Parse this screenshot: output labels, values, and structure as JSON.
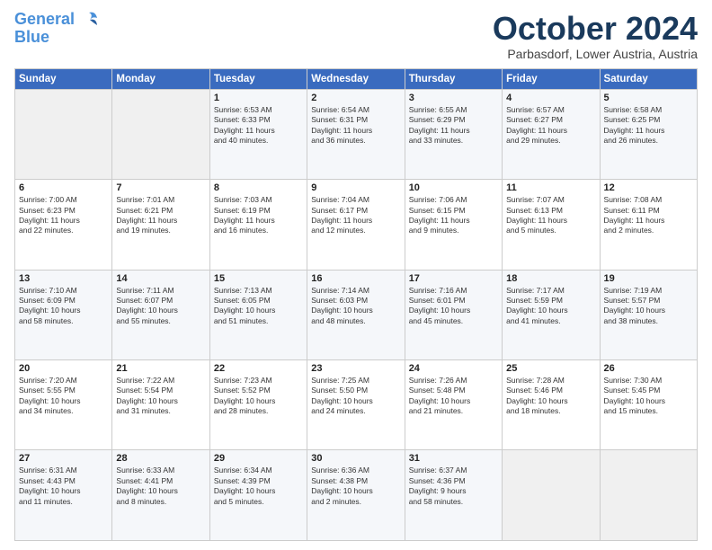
{
  "logo": {
    "line1": "General",
    "line2": "Blue"
  },
  "title": "October 2024",
  "location": "Parbasdorf, Lower Austria, Austria",
  "weekdays": [
    "Sunday",
    "Monday",
    "Tuesday",
    "Wednesday",
    "Thursday",
    "Friday",
    "Saturday"
  ],
  "weeks": [
    [
      {
        "day": "",
        "info": ""
      },
      {
        "day": "",
        "info": ""
      },
      {
        "day": "1",
        "info": "Sunrise: 6:53 AM\nSunset: 6:33 PM\nDaylight: 11 hours\nand 40 minutes."
      },
      {
        "day": "2",
        "info": "Sunrise: 6:54 AM\nSunset: 6:31 PM\nDaylight: 11 hours\nand 36 minutes."
      },
      {
        "day": "3",
        "info": "Sunrise: 6:55 AM\nSunset: 6:29 PM\nDaylight: 11 hours\nand 33 minutes."
      },
      {
        "day": "4",
        "info": "Sunrise: 6:57 AM\nSunset: 6:27 PM\nDaylight: 11 hours\nand 29 minutes."
      },
      {
        "day": "5",
        "info": "Sunrise: 6:58 AM\nSunset: 6:25 PM\nDaylight: 11 hours\nand 26 minutes."
      }
    ],
    [
      {
        "day": "6",
        "info": "Sunrise: 7:00 AM\nSunset: 6:23 PM\nDaylight: 11 hours\nand 22 minutes."
      },
      {
        "day": "7",
        "info": "Sunrise: 7:01 AM\nSunset: 6:21 PM\nDaylight: 11 hours\nand 19 minutes."
      },
      {
        "day": "8",
        "info": "Sunrise: 7:03 AM\nSunset: 6:19 PM\nDaylight: 11 hours\nand 16 minutes."
      },
      {
        "day": "9",
        "info": "Sunrise: 7:04 AM\nSunset: 6:17 PM\nDaylight: 11 hours\nand 12 minutes."
      },
      {
        "day": "10",
        "info": "Sunrise: 7:06 AM\nSunset: 6:15 PM\nDaylight: 11 hours\nand 9 minutes."
      },
      {
        "day": "11",
        "info": "Sunrise: 7:07 AM\nSunset: 6:13 PM\nDaylight: 11 hours\nand 5 minutes."
      },
      {
        "day": "12",
        "info": "Sunrise: 7:08 AM\nSunset: 6:11 PM\nDaylight: 11 hours\nand 2 minutes."
      }
    ],
    [
      {
        "day": "13",
        "info": "Sunrise: 7:10 AM\nSunset: 6:09 PM\nDaylight: 10 hours\nand 58 minutes."
      },
      {
        "day": "14",
        "info": "Sunrise: 7:11 AM\nSunset: 6:07 PM\nDaylight: 10 hours\nand 55 minutes."
      },
      {
        "day": "15",
        "info": "Sunrise: 7:13 AM\nSunset: 6:05 PM\nDaylight: 10 hours\nand 51 minutes."
      },
      {
        "day": "16",
        "info": "Sunrise: 7:14 AM\nSunset: 6:03 PM\nDaylight: 10 hours\nand 48 minutes."
      },
      {
        "day": "17",
        "info": "Sunrise: 7:16 AM\nSunset: 6:01 PM\nDaylight: 10 hours\nand 45 minutes."
      },
      {
        "day": "18",
        "info": "Sunrise: 7:17 AM\nSunset: 5:59 PM\nDaylight: 10 hours\nand 41 minutes."
      },
      {
        "day": "19",
        "info": "Sunrise: 7:19 AM\nSunset: 5:57 PM\nDaylight: 10 hours\nand 38 minutes."
      }
    ],
    [
      {
        "day": "20",
        "info": "Sunrise: 7:20 AM\nSunset: 5:55 PM\nDaylight: 10 hours\nand 34 minutes."
      },
      {
        "day": "21",
        "info": "Sunrise: 7:22 AM\nSunset: 5:54 PM\nDaylight: 10 hours\nand 31 minutes."
      },
      {
        "day": "22",
        "info": "Sunrise: 7:23 AM\nSunset: 5:52 PM\nDaylight: 10 hours\nand 28 minutes."
      },
      {
        "day": "23",
        "info": "Sunrise: 7:25 AM\nSunset: 5:50 PM\nDaylight: 10 hours\nand 24 minutes."
      },
      {
        "day": "24",
        "info": "Sunrise: 7:26 AM\nSunset: 5:48 PM\nDaylight: 10 hours\nand 21 minutes."
      },
      {
        "day": "25",
        "info": "Sunrise: 7:28 AM\nSunset: 5:46 PM\nDaylight: 10 hours\nand 18 minutes."
      },
      {
        "day": "26",
        "info": "Sunrise: 7:30 AM\nSunset: 5:45 PM\nDaylight: 10 hours\nand 15 minutes."
      }
    ],
    [
      {
        "day": "27",
        "info": "Sunrise: 6:31 AM\nSunset: 4:43 PM\nDaylight: 10 hours\nand 11 minutes."
      },
      {
        "day": "28",
        "info": "Sunrise: 6:33 AM\nSunset: 4:41 PM\nDaylight: 10 hours\nand 8 minutes."
      },
      {
        "day": "29",
        "info": "Sunrise: 6:34 AM\nSunset: 4:39 PM\nDaylight: 10 hours\nand 5 minutes."
      },
      {
        "day": "30",
        "info": "Sunrise: 6:36 AM\nSunset: 4:38 PM\nDaylight: 10 hours\nand 2 minutes."
      },
      {
        "day": "31",
        "info": "Sunrise: 6:37 AM\nSunset: 4:36 PM\nDaylight: 9 hours\nand 58 minutes."
      },
      {
        "day": "",
        "info": ""
      },
      {
        "day": "",
        "info": ""
      }
    ]
  ]
}
